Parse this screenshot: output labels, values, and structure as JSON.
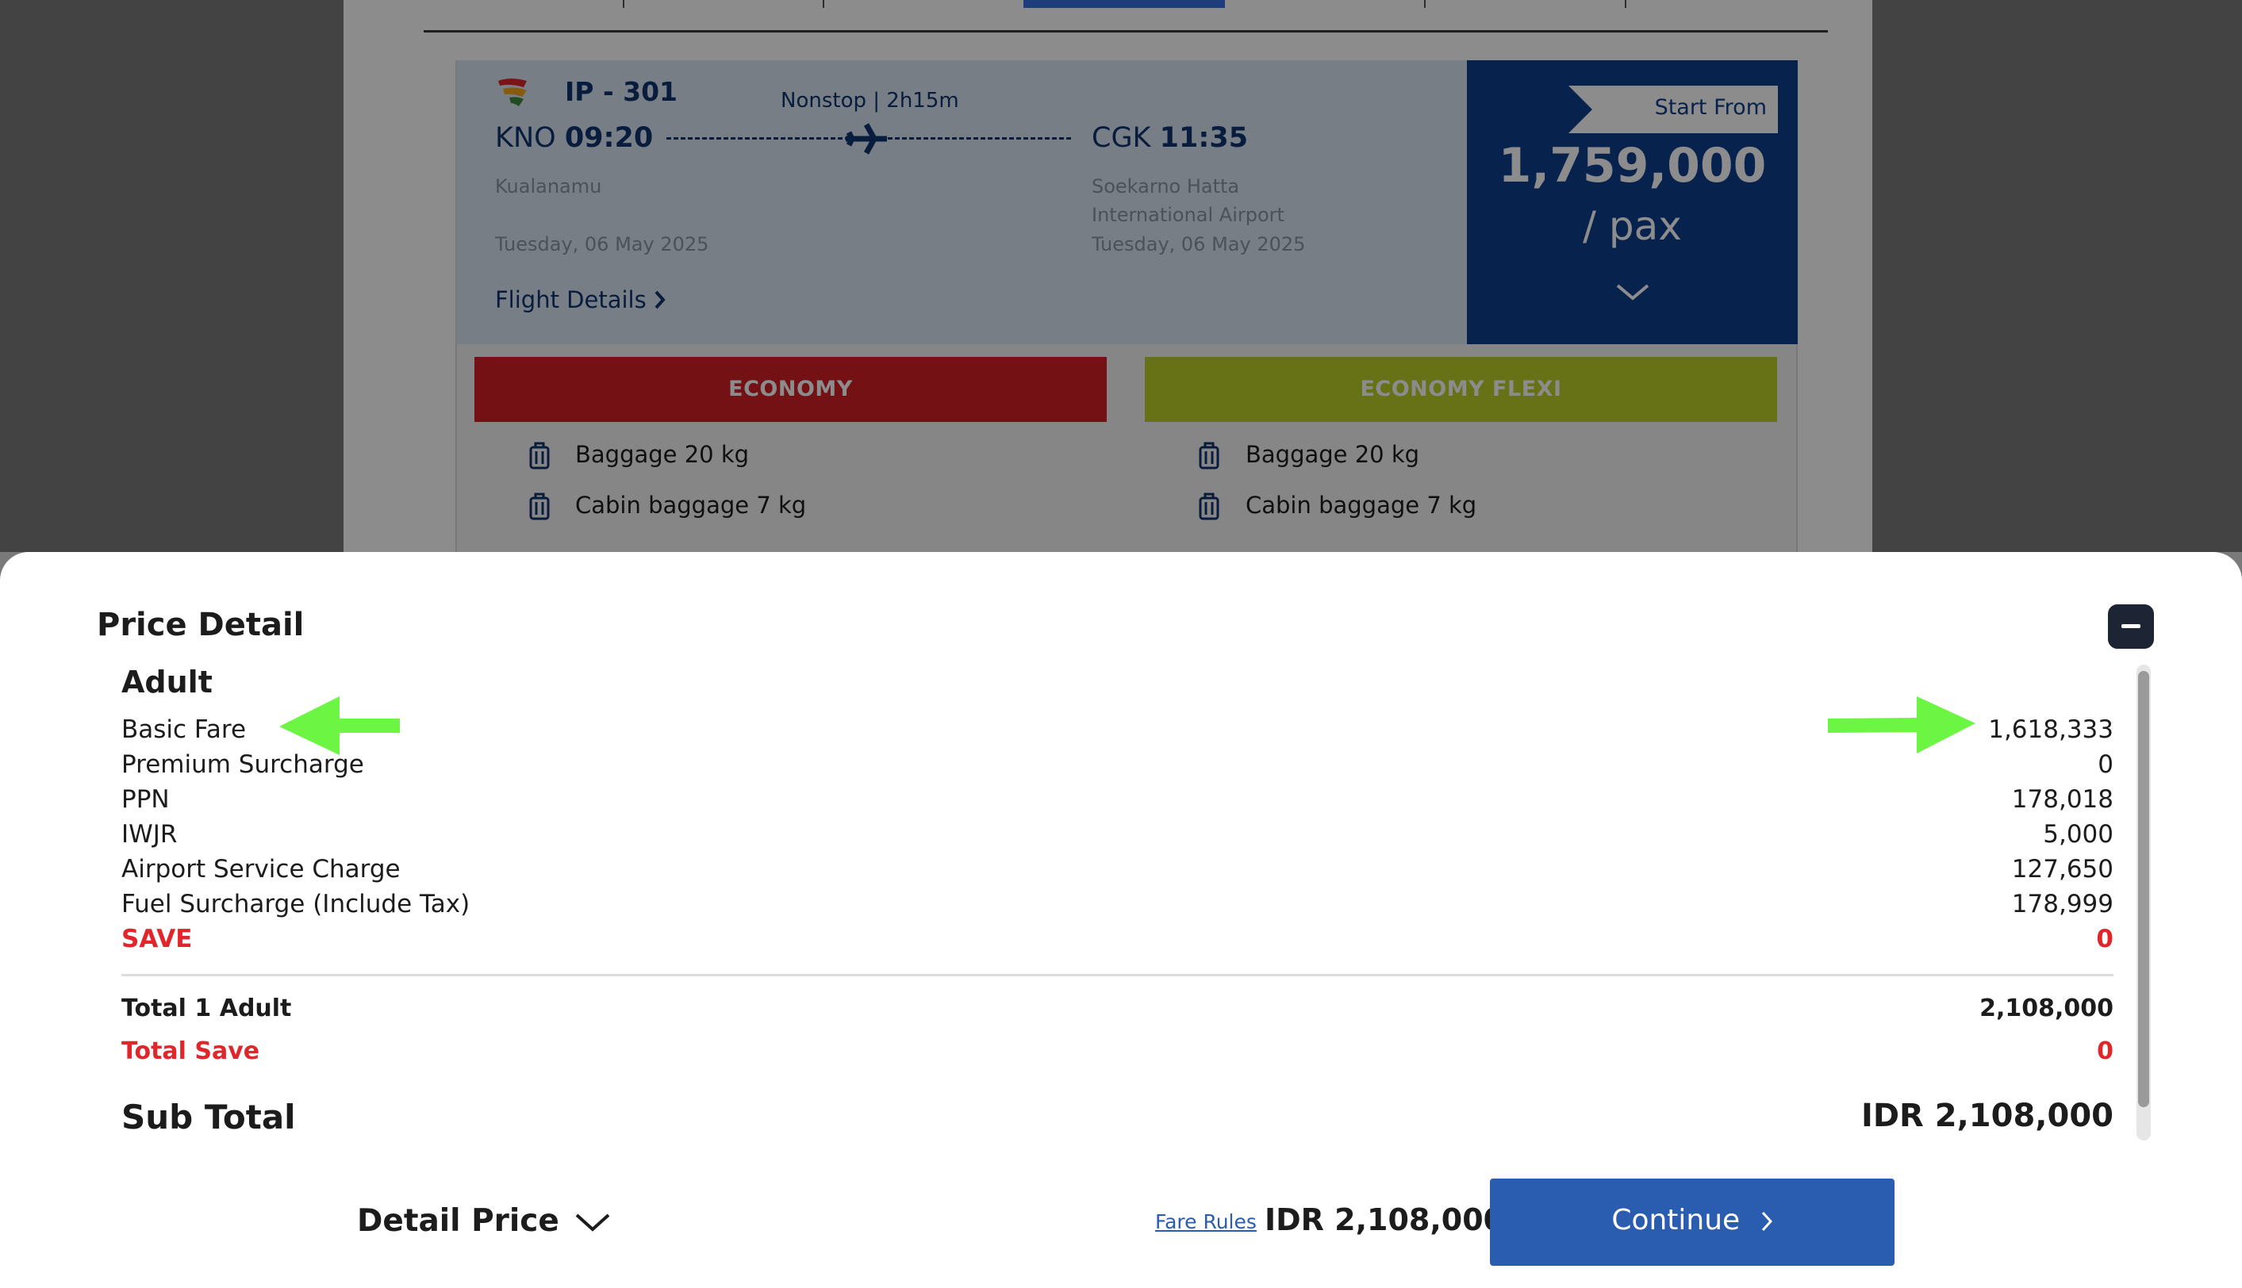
{
  "flight": {
    "code": "IP - 301",
    "duration": "Nonstop | 2h15m",
    "dep_code": "KNO",
    "dep_time": "09:20",
    "dep_airport": "Kualanamu",
    "dep_date": "Tuesday, 06 May 2025",
    "arr_code": "CGK",
    "arr_time": "11:35",
    "arr_airport_line1": "Soekarno Hatta",
    "arr_airport_line2": "International Airport",
    "arr_date": "Tuesday, 06 May 2025",
    "details_link": "Flight Details"
  },
  "price_box": {
    "ribbon": "Start From",
    "amount": "1,759,000",
    "unit": "/ pax"
  },
  "fares": [
    {
      "name": "ECONOMY",
      "color": "#d21f27",
      "features": [
        "Baggage 20 kg",
        "Cabin baggage 7 kg"
      ]
    },
    {
      "name": "ECONOMY FLEXI",
      "color": "#bccf2a",
      "features": [
        "Baggage 20 kg",
        "Cabin baggage 7 kg"
      ]
    }
  ],
  "price_detail": {
    "title": "Price Detail",
    "passenger_type": "Adult",
    "rows": [
      {
        "label": "Basic Fare",
        "value": "1,618,333"
      },
      {
        "label": "Premium Surcharge",
        "value": "0"
      },
      {
        "label": "PPN",
        "value": "178,018"
      },
      {
        "label": "IWJR",
        "value": "5,000"
      },
      {
        "label": "Airport Service Charge",
        "value": "127,650"
      },
      {
        "label": "Fuel Surcharge (Include Tax)",
        "value": "178,999"
      }
    ],
    "save_label": "SAVE",
    "save_value": "0",
    "total_label": "Total 1 Adult",
    "total_value": "2,108,000",
    "total_save_label": "Total Save",
    "total_save_value": "0",
    "subtotal_label": "Sub Total",
    "subtotal_value": "IDR 2,108,000"
  },
  "footer": {
    "detail_price": "Detail Price",
    "fare_rules": "Fare Rules",
    "total": "IDR 2,108,000",
    "continue": "Continue"
  },
  "colors": {
    "accent_blue": "#2a5db0",
    "navy": "#0f3f8f",
    "save_red": "#e1262b",
    "arrow_green": "#6cf542"
  },
  "icons": [
    "airline-logo-icon",
    "plane-icon",
    "chevron-right-icon",
    "chevron-down-icon",
    "luggage-icon",
    "minus-icon",
    "arrow-left-icon",
    "arrow-right-icon"
  ]
}
